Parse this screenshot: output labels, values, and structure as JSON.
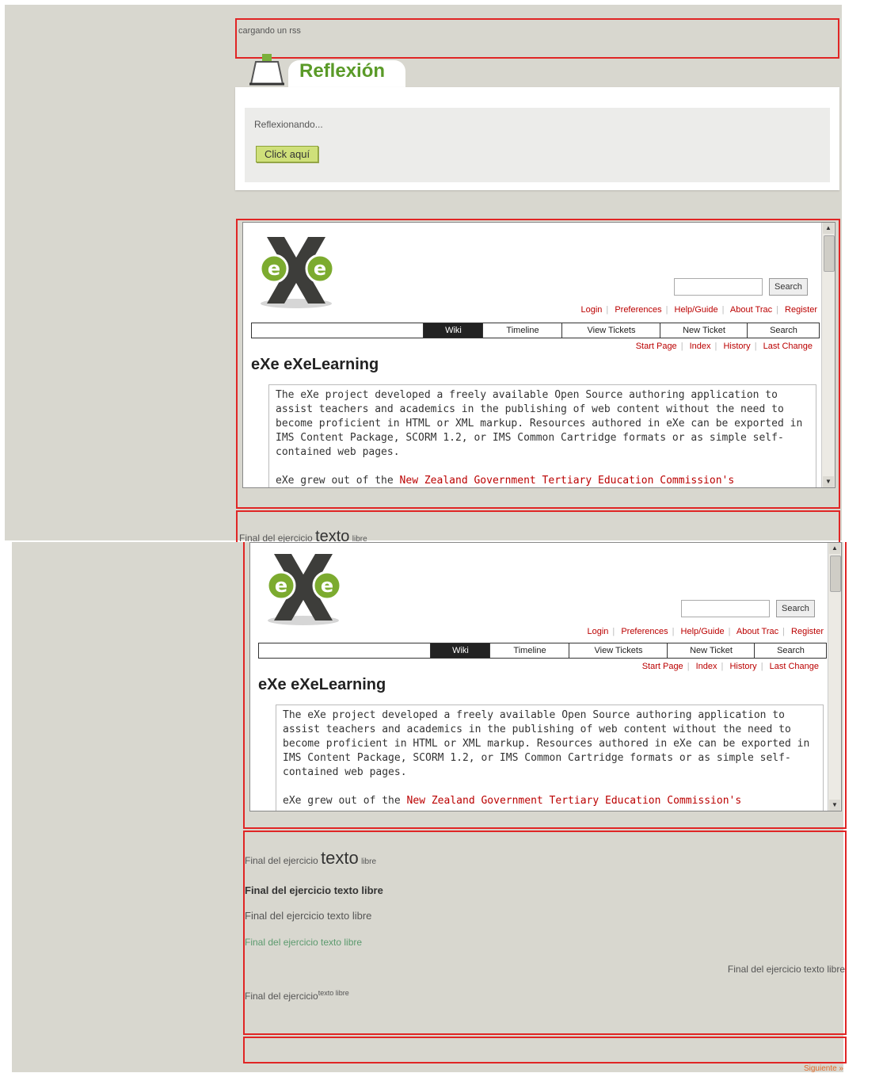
{
  "top": {
    "rss_text": "cargando un rss",
    "reflexion": {
      "title": "Reflexión",
      "body_text": "Reflexionando...",
      "button_label": "Click aquí"
    },
    "footer_snippet": {
      "pre": "Final del ejercicio",
      "big": "texto",
      "post": "libre"
    }
  },
  "trac": {
    "search_button": "Search",
    "metanav": [
      "Login",
      "Preferences",
      "Help/Guide",
      "About Trac",
      "Register"
    ],
    "mainnav": [
      "Wiki",
      "Timeline",
      "View Tickets",
      "New Ticket",
      "Search"
    ],
    "mainnav_active": "Wiki",
    "ctxtnav": [
      "Start Page",
      "Index",
      "History",
      "Last Change"
    ],
    "page_title": "eXe eXeLearning",
    "paragraph1": "The eXe project developed a freely available Open Source authoring application to assist teachers and academics in the publishing of web content without the need to become proficient in HTML or XML markup. Resources authored in eXe can be exported in IMS Content Package, SCORM 1.2, or IMS Common Cartridge formats or as simple self-contained web pages.",
    "paragraph2_prefix": "eXe grew out of the ",
    "paragraph2_link": "New Zealand Government Tertiary Education Commission's"
  },
  "bottom": {
    "line1_pre": "Final del ejercicio",
    "line1_big": "texto",
    "line1_post": "libre",
    "line2": "Final del ejercicio texto libre",
    "line3": "Final del ejercicio texto libre",
    "line4": "Final del ejercicio texto libre",
    "line5": "Final del ejercicio texto libre",
    "line6_pre": "Final del ejercicio",
    "line6_sup": "texto libre",
    "corner_link": "Siguiente »"
  },
  "colors": {
    "background": "#d8d7cf",
    "red_outline": "#e02525",
    "reflexion_green": "#5a9a28",
    "link_red": "#b00000"
  }
}
